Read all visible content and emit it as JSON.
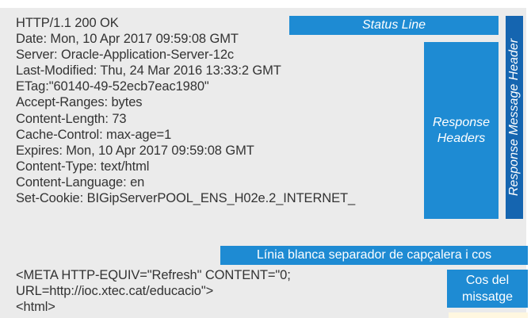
{
  "response_lines": [
    "HTTP/1.1 200 OK",
    "Date: Mon, 10 Apr 2017 09:59:08 GMT",
    "Server: Oracle-Application-Server-12c",
    "Last-Modified: Thu, 24 Mar 2016 13:33:2 GMT",
    "ETag:\"60140-49-52ecb7eac1980\"",
    "Accept-Ranges: bytes",
    "Content-Length: 73",
    "Cache-Control: max-age=1",
    "Expires: Mon, 10 Apr 2017 09:59:08 GMT",
    "Content-Type: text/html",
    "Content-Language: en",
    "Set-Cookie: BIGipServerPOOL_ENS_H02e.2_INTERNET_"
  ],
  "body_lines": [
    "<META HTTP-EQUIV=\"Refresh\" CONTENT=\"0;",
    "URL=http://ioc.xtec.cat/educacio\">",
    "<html>"
  ],
  "labels": {
    "status_line": "Status Line",
    "response_headers_1": "Response",
    "response_headers_2": "Headers",
    "response_message_header": "Response Message Header",
    "separator": "Línia blanca separador de capçalera i cos",
    "body_1": "Cos del",
    "body_2": "missatge"
  },
  "colors": {
    "panel": "#ebebeb",
    "label_blue": "#1e8bd3",
    "label_dark_blue": "#1565b0",
    "text": "#333333"
  }
}
